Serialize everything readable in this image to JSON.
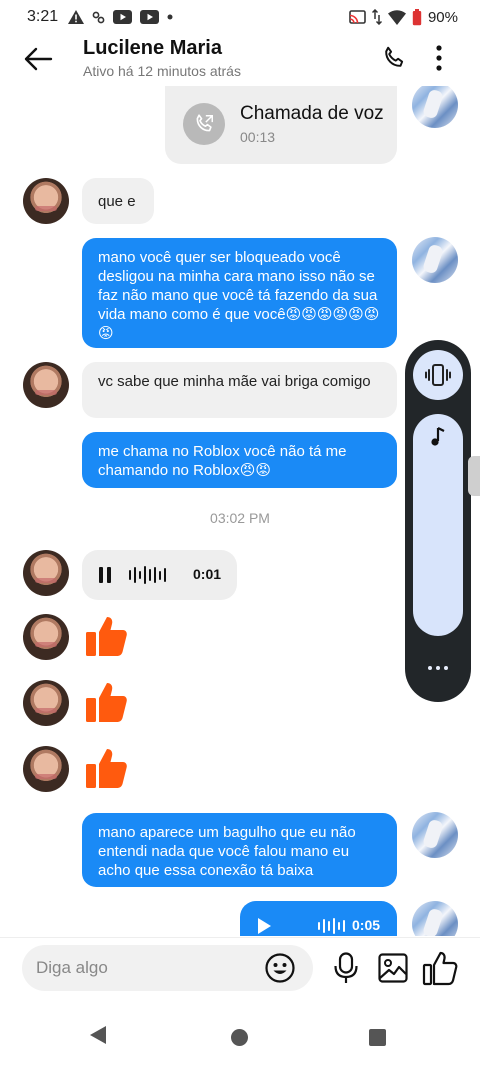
{
  "status_bar": {
    "time": "3:21",
    "battery": "90%",
    "icons": [
      "alert-icon",
      "app-icon",
      "youtube-icon",
      "youtube-icon",
      "dot-icon",
      "cast-icon",
      "data-arrows-icon",
      "wifi-icon",
      "battery-icon"
    ]
  },
  "header": {
    "name": "Lucilene Maria",
    "status": "Ativo há 12 minutos atrás",
    "icons": [
      "back-arrow-icon",
      "phone-icon",
      "more-vertical-icon"
    ]
  },
  "messages": {
    "call": {
      "title": "Chamada de voz",
      "duration": "00:13"
    },
    "m1": "que e",
    "m2": "mano você quer ser bloqueado você desligou na minha cara mano isso não se faz não mano que você tá fazendo da sua vida mano como é que você😡😡😡😡😡😡😡",
    "m3": "vc sabe que minha mãe vai briga comigo",
    "m4": "me chama no Roblox você não tá me chamando no Roblox😠😡",
    "timestamp": "03:02 PM",
    "audio_in": {
      "duration": "0:01",
      "state": "playing"
    },
    "likes_count": 3,
    "m5": "mano aparece um bagulho que eu não entendi nada que você falou mano eu acho que essa conexão tá baixa",
    "audio_out": {
      "duration": "0:05",
      "state": "paused"
    }
  },
  "volume_panel": {
    "mode": "vibrate",
    "level": 0,
    "icons": [
      "vibrate-icon",
      "music-note-icon",
      "more-horizontal-icon"
    ]
  },
  "composer": {
    "placeholder": "Diga algo",
    "icons": [
      "emoji-icon",
      "microphone-icon",
      "image-icon",
      "thumbs-up-icon"
    ]
  },
  "colors": {
    "outgoing_bubble": "#1a8af6",
    "incoming_bubble": "#f0f0f0",
    "like": "#ff5a0e",
    "volume_panel": "#222629",
    "volume_accent": "#d8e4fb"
  },
  "nav": {
    "icons": [
      "nav-back-icon",
      "nav-home-icon",
      "nav-recents-icon"
    ]
  }
}
